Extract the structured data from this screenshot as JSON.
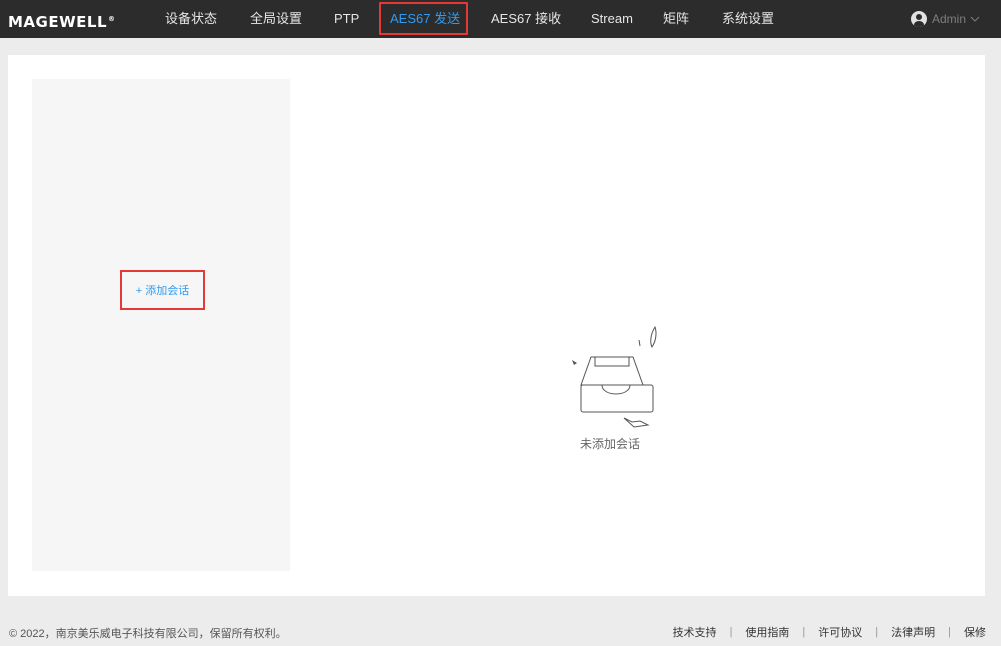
{
  "header": {
    "logo": "MAGEWELL",
    "nav": [
      {
        "label": "设备状态"
      },
      {
        "label": "全局设置"
      },
      {
        "label": "PTP"
      },
      {
        "label": "AES67 发送"
      },
      {
        "label": "AES67 接收"
      },
      {
        "label": "Stream"
      },
      {
        "label": "矩阵"
      },
      {
        "label": "系统设置"
      }
    ],
    "active_index": 3,
    "user": "Admin",
    "accent_color": "#2e9bf0"
  },
  "main": {
    "add_session_label": "+ 添加会话",
    "empty_text": "未添加会话"
  },
  "footer": {
    "copyright": "© 2022，南京美乐威电子科技有限公司，保留所有权利。",
    "links": [
      "技术支持",
      "使用指南",
      "许可协议",
      "法律声明",
      "保修"
    ]
  }
}
